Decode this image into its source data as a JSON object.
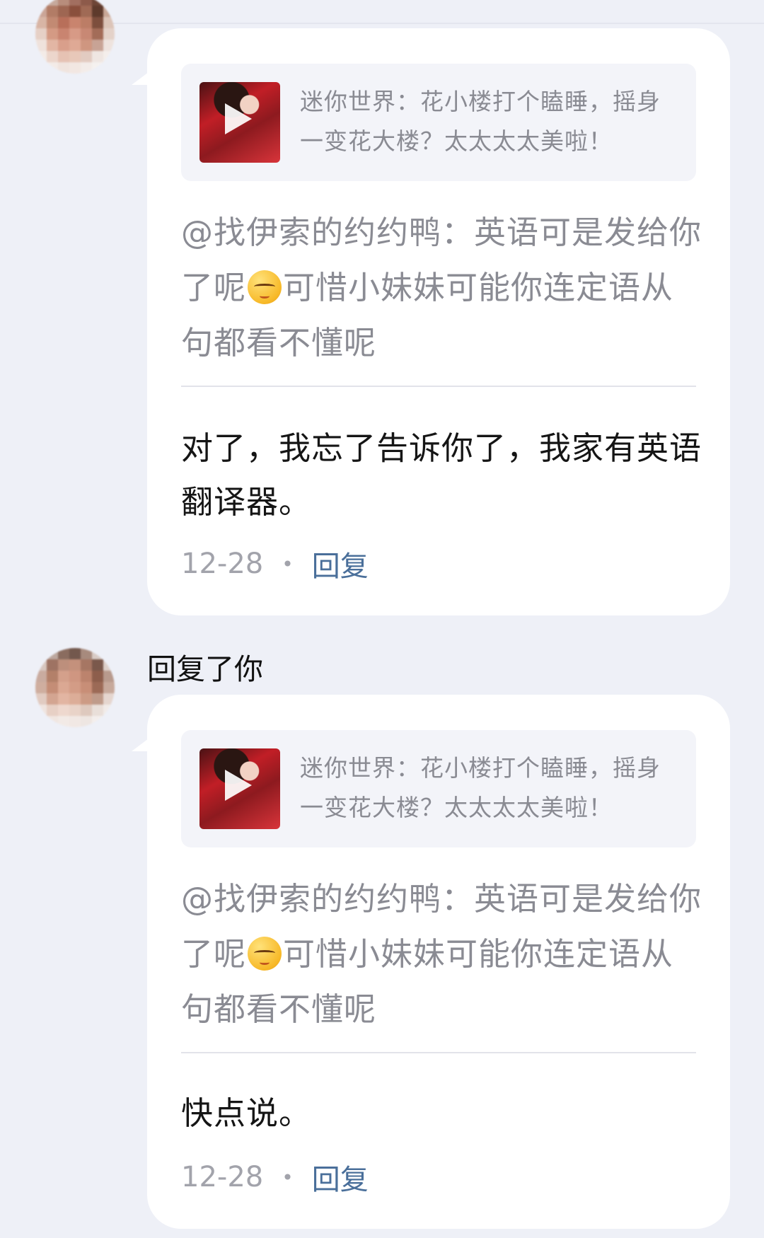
{
  "items": [
    {
      "quote": "迷你世界：花小楼打个瞌睡，摇身一变花大楼？太太太太美啦！",
      "parent_before_emoji": "@找伊索的约约鸭：英语可是发给你了呢",
      "parent_after_emoji": "可惜小妹妹可能你连定语从句都看不懂呢",
      "reply": "对了，我忘了告诉你了，我家有英语翻译器。",
      "date": "12-28",
      "dot": "•",
      "reply_label": "回复"
    },
    {
      "notice": "回复了你",
      "quote": "迷你世界：花小楼打个瞌睡，摇身一变花大楼？太太太太美啦！",
      "parent_before_emoji": "@找伊索的约约鸭：英语可是发给你了呢",
      "parent_after_emoji": "可惜小妹妹可能你连定语从句都看不懂呢",
      "reply": "快点说。",
      "date": "12-28",
      "dot": "•",
      "reply_label": "回复"
    }
  ]
}
